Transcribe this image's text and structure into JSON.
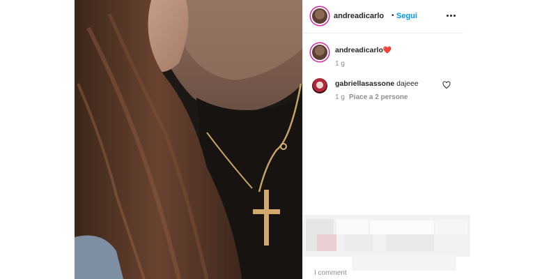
{
  "post": {
    "author": "andreadicarlo",
    "follow_label": "Segui",
    "dot": "•",
    "more_icon": "more-horizontal-icon"
  },
  "caption": {
    "username": "andreadicarlo",
    "emoji": "❤️",
    "time": "1 g"
  },
  "comments": [
    {
      "username": "gabriellasassone",
      "text": "dajeee",
      "time": "1 g",
      "likes": "Piace a 2 persone"
    }
  ],
  "footer": {
    "comments_hint": "I comment"
  },
  "colors": {
    "accent": "#0095f6",
    "text": "#262626",
    "muted": "#8e8e8e",
    "heart": "#e0245e"
  }
}
